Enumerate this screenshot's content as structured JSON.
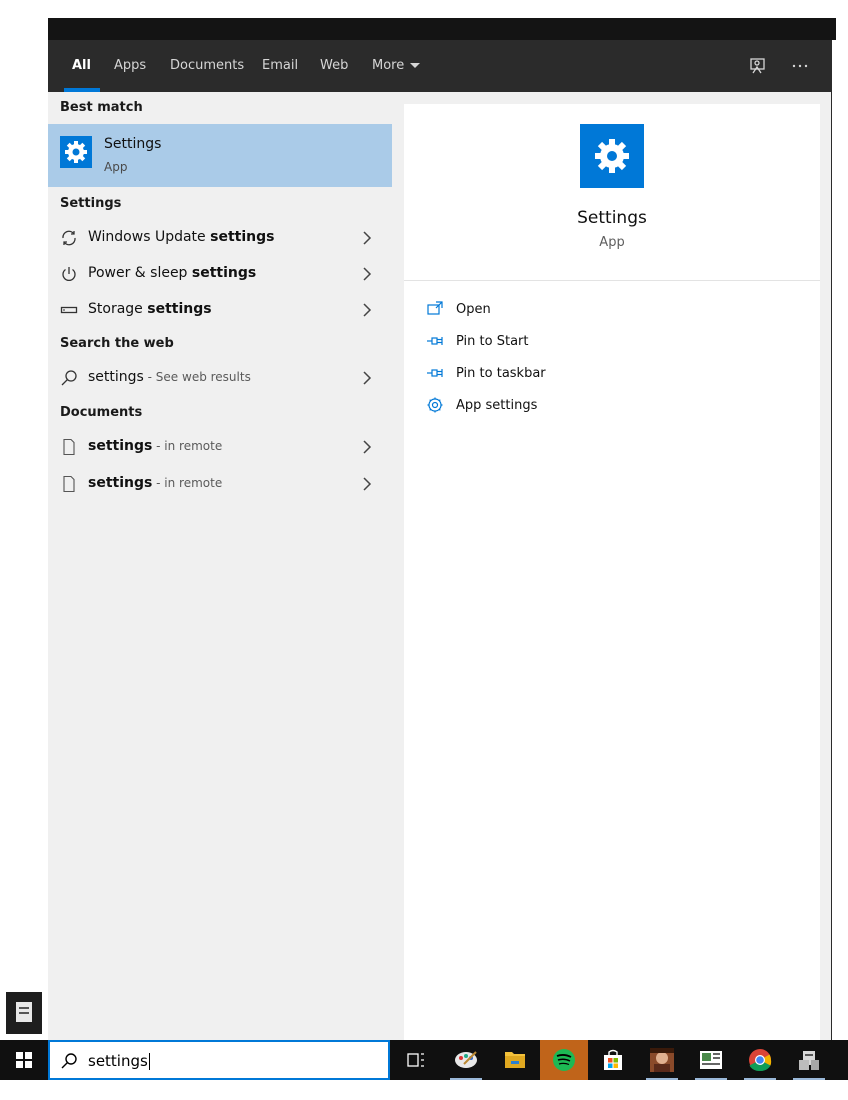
{
  "tabs": [
    {
      "label": "All",
      "active": true
    },
    {
      "label": "Apps"
    },
    {
      "label": "Documents"
    },
    {
      "label": "Email"
    },
    {
      "label": "Web"
    },
    {
      "label": "More"
    }
  ],
  "toolbar_icons": [
    "feedback-icon",
    "more-options-icon"
  ],
  "best_match": {
    "header": "Best match",
    "title": "Settings",
    "subtitle": "App",
    "icon": "gear-icon"
  },
  "settings_section": {
    "header": "Settings",
    "items": [
      {
        "icon": "sync-icon",
        "prefix": "Windows Update ",
        "bold": "settings"
      },
      {
        "icon": "power-icon",
        "prefix": "Power & sleep ",
        "bold": "settings"
      },
      {
        "icon": "storage-icon",
        "prefix": "Storage ",
        "bold": "settings"
      }
    ]
  },
  "web_section": {
    "header": "Search the web",
    "items": [
      {
        "icon": "search-icon",
        "bold": "settings",
        "suffix": " - See web results"
      }
    ]
  },
  "documents_section": {
    "header": "Documents",
    "items": [
      {
        "icon": "document-icon",
        "bold": "settings",
        "suffix": " - in remote"
      },
      {
        "icon": "document-icon",
        "bold": "settings",
        "suffix": " - in remote"
      }
    ]
  },
  "preview": {
    "title": "Settings",
    "subtitle": "App",
    "actions": [
      {
        "label": "Open",
        "icon": "open-window-icon"
      },
      {
        "label": "Pin to Start",
        "icon": "pin-icon"
      },
      {
        "label": "Pin to taskbar",
        "icon": "pin-icon"
      },
      {
        "label": "App settings",
        "icon": "gear-icon"
      }
    ]
  },
  "search": {
    "query": "settings"
  },
  "taskbar": {
    "items": [
      "windows-start-icon",
      "task-view-icon",
      "paint-app-icon",
      "file-explorer-icon",
      "spotify-icon",
      "store-icon",
      "game-app-icon",
      "news-app-icon",
      "chrome-icon",
      "network-app-icon"
    ]
  },
  "colors": {
    "accent": "#0078d7",
    "best_match_bg": "#aacbe8",
    "tab_bar": "#2b2b2b",
    "taskbar": "#101010",
    "spotify_active": "#c0641a"
  }
}
